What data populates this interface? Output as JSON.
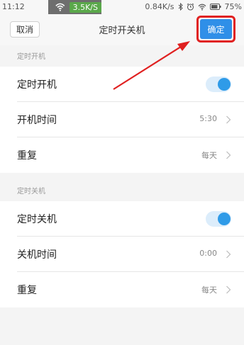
{
  "status_bar": {
    "time": "11:12",
    "net_speed_badge": "3.5K/S",
    "net_speed": "0.84K/s",
    "battery": "75%",
    "icons": [
      "wifi-icon",
      "bluetooth-icon",
      "alarm-icon",
      "wifi-icon",
      "battery-icon"
    ]
  },
  "header": {
    "cancel_label": "取消",
    "title": "定时开关机",
    "confirm_label": "确定"
  },
  "power_on": {
    "section_title": "定时开机",
    "toggle_label": "定时开机",
    "toggle_on": true,
    "time_label": "开机时间",
    "time_value": "5:30",
    "repeat_label": "重复",
    "repeat_value": "每天"
  },
  "power_off": {
    "section_title": "定时关机",
    "toggle_label": "定时关机",
    "toggle_on": true,
    "time_label": "关机时间",
    "time_value": "0:00",
    "repeat_label": "重复",
    "repeat_value": "每天"
  },
  "colors": {
    "accent": "#2f8fe8",
    "highlight": "#e02020",
    "toggle_knob": "#2f9be8"
  }
}
